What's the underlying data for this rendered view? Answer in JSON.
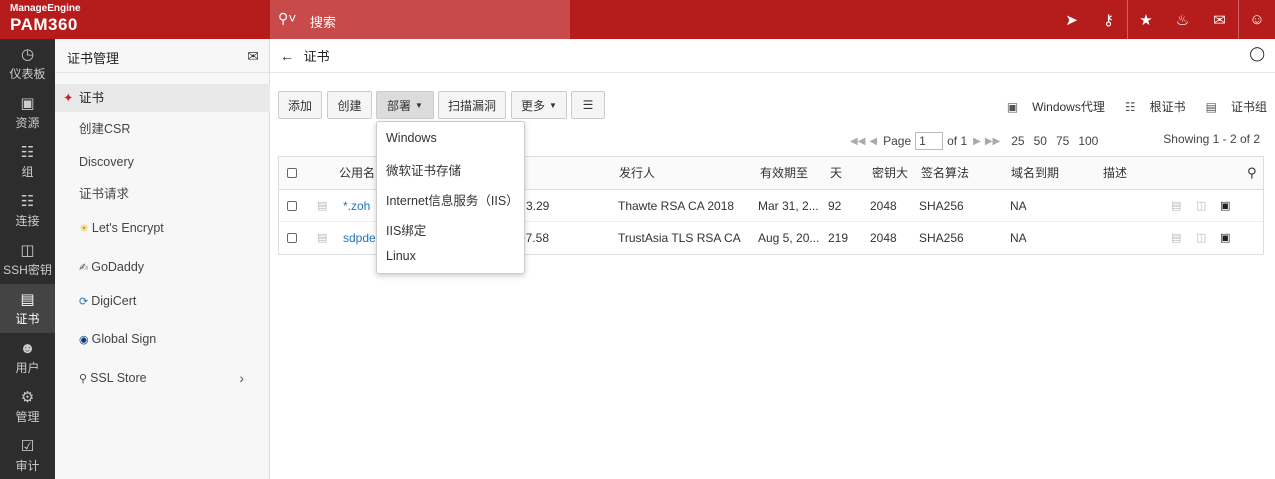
{
  "brand": {
    "company": "ManageEngine",
    "product": "PAM360"
  },
  "search": {
    "placeholder": "搜索"
  },
  "nav": [
    {
      "label": "仪表板",
      "icon": "dashboard-icon"
    },
    {
      "label": "资源",
      "icon": "monitor-icon"
    },
    {
      "label": "组",
      "icon": "group-icon"
    },
    {
      "label": "连接",
      "icon": "connection-icon"
    },
    {
      "label": "SSH密钥",
      "icon": "ssh-key-icon"
    },
    {
      "label": "证书",
      "icon": "certificate-icon"
    },
    {
      "label": "用户",
      "icon": "user-icon"
    },
    {
      "label": "管理",
      "icon": "gear-icon"
    },
    {
      "label": "审计",
      "icon": "audit-icon"
    }
  ],
  "sidebar": {
    "title": "证书管理",
    "items": [
      {
        "label": "证书"
      },
      {
        "label": "创建CSR"
      },
      {
        "label": "Discovery"
      },
      {
        "label": "证书请求"
      },
      {
        "label": "Let's Encrypt"
      },
      {
        "label": "GoDaddy"
      },
      {
        "label": "DigiCert"
      },
      {
        "label": "Global Sign"
      },
      {
        "label": "SSL Store"
      }
    ]
  },
  "breadcrumb": {
    "title": "证书"
  },
  "toolbar": {
    "add": "添加",
    "create": "创建",
    "deploy": "部署",
    "scan": "扫描漏洞",
    "more": "更多"
  },
  "right_links": {
    "windows_agent": "Windows代理",
    "root_cert": "根证书",
    "cert_group": "证书组"
  },
  "pager": {
    "page_label": "Page",
    "page_value": "1",
    "of_label": "of 1",
    "sizes": [
      "25",
      "50",
      "75",
      "100"
    ],
    "showing": "Showing 1 - 2 of 2"
  },
  "table": {
    "headers": {
      "common_name": "公用名",
      "sn": "",
      "issuer": "发行人",
      "expiry": "有效期至",
      "days": "天",
      "key_size": "密钥大",
      "sig_algo": "签名算法",
      "domain_expiry": "域名到期",
      "description": "描述"
    },
    "rows": [
      {
        "name": "*.zoh",
        "sn_tail": "3.29",
        "issuer": "Thawte RSA CA 2018",
        "expiry": "Mar 31, 2...",
        "days": "92",
        "key": "2048",
        "algo": "SHA256",
        "domain": "NA"
      },
      {
        "name": "sdpde",
        "sn_tail": "97.58",
        "issuer": "TrustAsia TLS RSA CA",
        "expiry": "Aug 5, 20...",
        "days": "219",
        "key": "2048",
        "algo": "SHA256",
        "domain": "NA"
      }
    ]
  },
  "deploy_menu": {
    "items": [
      "Windows",
      "微软证书存储",
      "Internet信息服务（IIS）",
      "IIS绑定",
      "Linux"
    ]
  },
  "colors": {
    "brand_red": "#b71c1c",
    "nav_dark": "#2d2d2d",
    "link_blue": "#1e73be"
  }
}
